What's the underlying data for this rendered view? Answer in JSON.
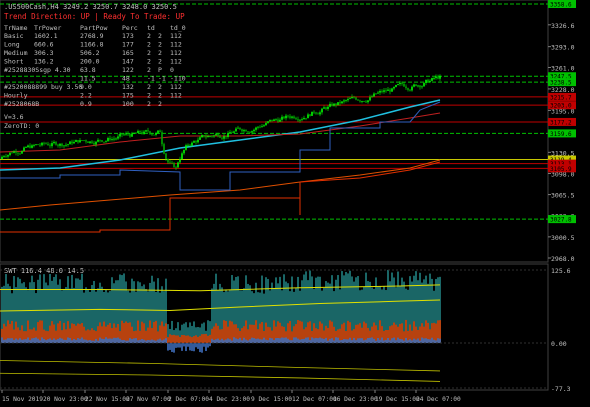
{
  "header": {
    "symbol_line": ".US500Cash,H4  3249.2 3250.7 3248.0 3250.5",
    "trend_line": "Trend Direction:  UP  |  Ready To Trade:  UP"
  },
  "stats_table": {
    "headers": [
      "TrName",
      "TrPower",
      "PartPow",
      "Perc",
      "td",
      "td_0"
    ],
    "rows": [
      [
        "Basic",
        "1602.1",
        "2768.9",
        "173",
        "2",
        "2",
        "112"
      ],
      [
        "Long",
        "660.6",
        "1166.8",
        "177",
        "2",
        "2",
        "112"
      ],
      [
        "Medium",
        "306.3",
        "506.2",
        "165",
        "2",
        "2",
        "112"
      ],
      [
        "Short",
        "136.2",
        "200.0",
        "147",
        "2",
        "2",
        "112"
      ],
      [
        "#2528830Ssgp 4.30",
        "",
        "63.8",
        "122",
        "2",
        "P",
        "0"
      ],
      [
        "",
        "",
        "11.5",
        "48",
        "-1",
        "-1",
        "-110"
      ],
      [
        "#2520088899 buy 3.50",
        "",
        "9.0",
        "132",
        "2",
        "2",
        "112"
      ],
      [
        "Hourly",
        "",
        "2.2",
        "175",
        "2",
        "2",
        "112"
      ],
      [
        "#2528068B",
        "",
        "0.9",
        "100",
        "2",
        "2",
        ""
      ]
    ],
    "extra": [
      "V=3.6",
      "ZeroTD:  0"
    ]
  },
  "price_axis": {
    "ticks": [
      "3326.6",
      "3293.0",
      "3261.0",
      "3228.0",
      "3195.0",
      "3162.0",
      "3130.5",
      "3098.0",
      "3065.5",
      "3033.0",
      "3000.5",
      "2968.0"
    ],
    "badges": [
      {
        "label": "3358.6",
        "color": "#00c000"
      },
      {
        "label": "3247.5",
        "color": "#00c000"
      },
      {
        "label": "3238.5",
        "color": "#00c000"
      },
      {
        "label": "3215.7",
        "color": "#c00000"
      },
      {
        "label": "3203.0",
        "color": "#c00000"
      },
      {
        "label": "3177.2",
        "color": "#c00000"
      },
      {
        "label": "3159.6",
        "color": "#00c000"
      },
      {
        "label": "3119.4",
        "color": "#c8c800"
      },
      {
        "label": "3113.1",
        "color": "#c00000"
      },
      {
        "label": "3105.9",
        "color": "#c00000"
      },
      {
        "label": "3027.8",
        "color": "#00c000"
      }
    ]
  },
  "indicator": {
    "label": "SWT 116.4 48.0 14.5",
    "ticks": [
      "125.6",
      "0.00",
      "-77.3"
    ]
  },
  "time_axis": [
    "15 Nov 2019",
    "20 Nov 23:00",
    "22 Nov 15:00",
    "27 Nov 07:00",
    "2 Dec 07:00",
    "4 Dec 23:00",
    "9 Dec 15:00",
    "12 Dec 07:00",
    "16 Dec 23:00",
    "19 Dec 15:00",
    "24 Dec 07:00"
  ],
  "colors": {
    "background": "#000000",
    "bull": "#00ff00",
    "bear": "#00aa00",
    "ma_cyan": "#20c0e0",
    "ma_red": "#c02020",
    "ma_orange": "#e05000",
    "ma_blue": "#3060c0",
    "grid": "#1a1a1a",
    "text": "#c0c0c0",
    "trend_red": "#ff3030"
  }
}
